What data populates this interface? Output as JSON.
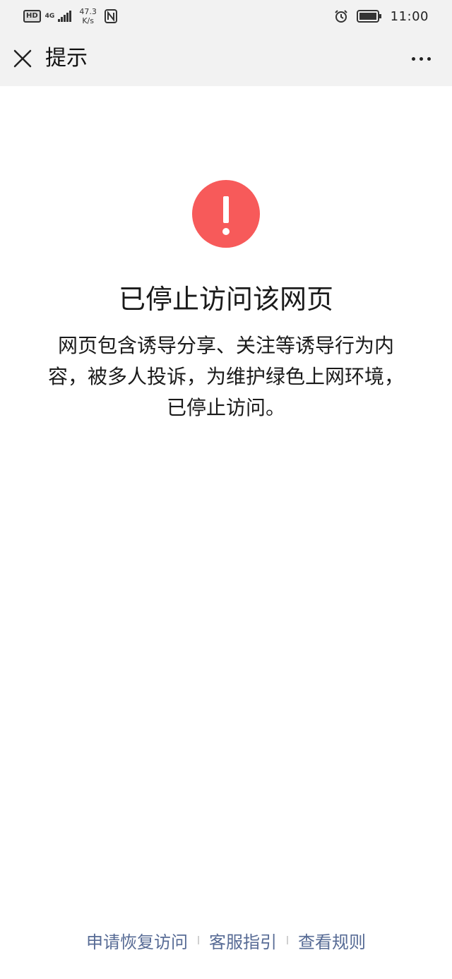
{
  "status_bar": {
    "badge": "HD",
    "network": "4G",
    "speed_value": "47.3",
    "speed_unit": "K/s",
    "time": "11:00"
  },
  "nav": {
    "title": "提示"
  },
  "content": {
    "headline": "已停止访问该网页",
    "description": "网页包含诱导分享、关注等诱导行为内容，被多人投诉，为维护绿色上网环境，已停止访问。"
  },
  "footer": {
    "links": [
      "申请恢复访问",
      "客服指引",
      "查看规则"
    ]
  },
  "colors": {
    "warning_red": "#f75a5a",
    "link_blue": "#576b95",
    "bar_bg": "#f2f2f2"
  }
}
